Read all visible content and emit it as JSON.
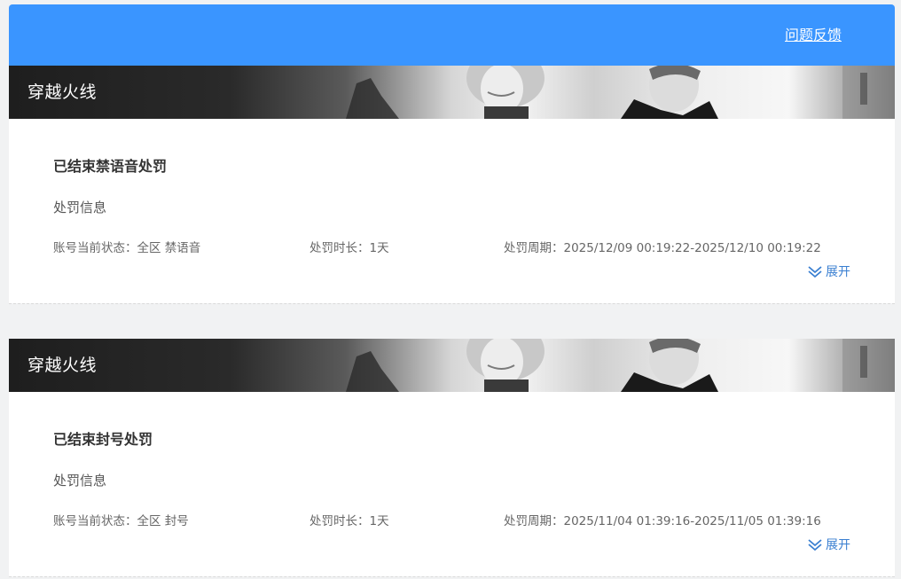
{
  "header": {
    "feedback_label": "问题反馈"
  },
  "records": [
    {
      "game_title": "穿越火线",
      "penalty_title": "已结束禁语音处罚",
      "section_label": "处罚信息",
      "status_label": "账号当前状态：",
      "status_value": "全区 禁语音",
      "duration_label": "处罚时长：",
      "duration_value": "1天",
      "period_label": "处罚周期：",
      "period_value": "2025/12/09 00:19:22-2025/12/10 00:19:22",
      "expand_label": "展开"
    },
    {
      "game_title": "穿越火线",
      "penalty_title": "已结束封号处罚",
      "section_label": "处罚信息",
      "status_label": "账号当前状态：",
      "status_value": "全区 封号",
      "duration_label": "处罚时长：",
      "duration_value": "1天",
      "period_label": "处罚周期：",
      "period_value": "2025/11/04 01:39:16-2025/11/05 01:39:16",
      "expand_label": "展开"
    }
  ],
  "colors": {
    "header_bg": "#3a95ff",
    "link": "#3a7fd1",
    "title_text": "#333333",
    "meta_text": "#666666"
  },
  "icons": {
    "expand": "double-chevron-down-icon"
  }
}
